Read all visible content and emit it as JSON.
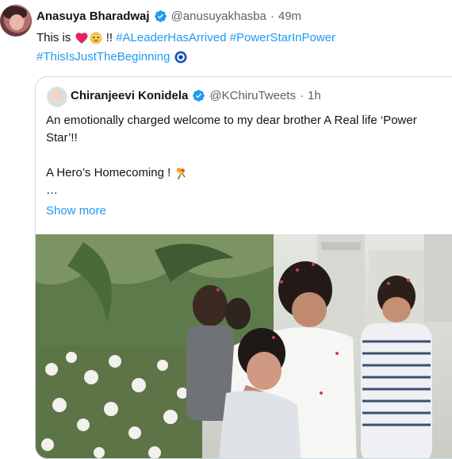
{
  "tweet": {
    "author_name": "Anasuya Bharadwaj",
    "handle": "@anusuyakhasba",
    "separator": "·",
    "time": "49m",
    "text_prefix": "This is",
    "text_bang": "!!",
    "hashtags": [
      "#ALeaderHasArrived",
      "#PowerStarInPower",
      "#ThisIsJustTheBeginning"
    ],
    "icons": [
      "red-heart-icon",
      "pleading-face-icon",
      "nazar-amulet-icon",
      "verified-badge-icon"
    ],
    "accent_color": "#1d9bf0"
  },
  "quoted": {
    "author_name": "Chiranjeevi Konidela",
    "handle": "@KChiruTweets",
    "separator": "·",
    "time": "1h",
    "line1": "An emotionally charged welcome to my dear brother A Real life ‘Power Star’!!",
    "line2": "A Hero’s Homecoming !",
    "ellipsis": "…",
    "show_more": "Show more",
    "icons": [
      "bouquet-icon",
      "verified-badge-icon"
    ]
  }
}
